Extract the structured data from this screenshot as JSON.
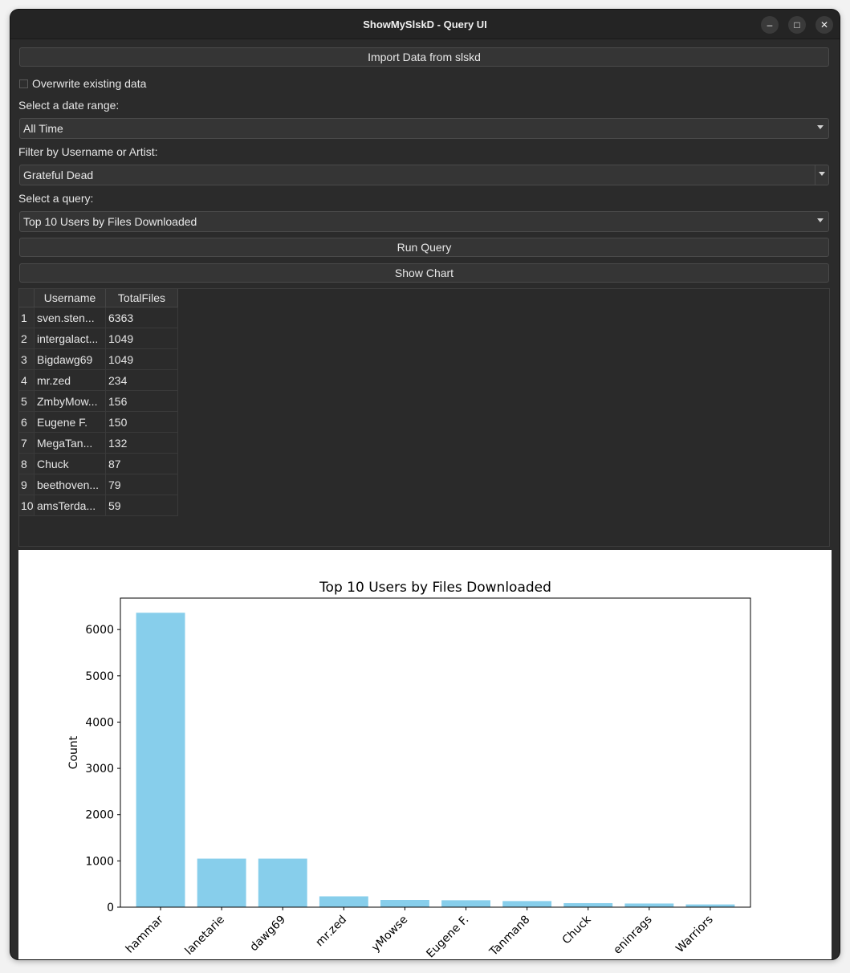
{
  "window": {
    "title": "ShowMySlskD - Query UI"
  },
  "controls": {
    "import_label": "Import Data from slskd",
    "overwrite_label": "Overwrite existing data",
    "date_range_label": "Select a date range:",
    "date_range_value": "All Time",
    "filter_label": "Filter by Username or Artist:",
    "filter_value": "Grateful Dead",
    "query_label": "Select a query:",
    "query_value": "Top 10 Users by Files Downloaded",
    "run_label": "Run Query",
    "chart_label": "Show Chart"
  },
  "table": {
    "headers": [
      "Username",
      "TotalFiles"
    ],
    "rows": [
      [
        "1",
        "sven.sten...",
        "6363"
      ],
      [
        "2",
        "intergalact...",
        "1049"
      ],
      [
        "3",
        "Bigdawg69",
        "1049"
      ],
      [
        "4",
        "mr.zed",
        "234"
      ],
      [
        "5",
        "ZmbyMow...",
        "156"
      ],
      [
        "6",
        "Eugene F.",
        "150"
      ],
      [
        "7",
        "MegaTan...",
        "132"
      ],
      [
        "8",
        "Chuck",
        "87"
      ],
      [
        "9",
        "beethoven...",
        "79"
      ],
      [
        "10",
        "amsTerda...",
        "59"
      ]
    ]
  },
  "chart_data": {
    "type": "bar",
    "title": "Top 10 Users by Files Downloaded",
    "xlabel": "",
    "ylabel": "Count",
    "categories": [
      "hammar",
      "lanetarie",
      "dawg69",
      "mr.zed",
      "yMowse",
      "Eugene F.",
      "Tanman8",
      "Chuck",
      "eninrags",
      "Warriors"
    ],
    "values": [
      6363,
      1049,
      1049,
      234,
      156,
      150,
      132,
      87,
      79,
      59
    ],
    "ylim": [
      0,
      6680
    ],
    "yticks": [
      0,
      1000,
      2000,
      3000,
      4000,
      5000,
      6000
    ],
    "bar_color": "#87ceeb",
    "grid": false
  }
}
